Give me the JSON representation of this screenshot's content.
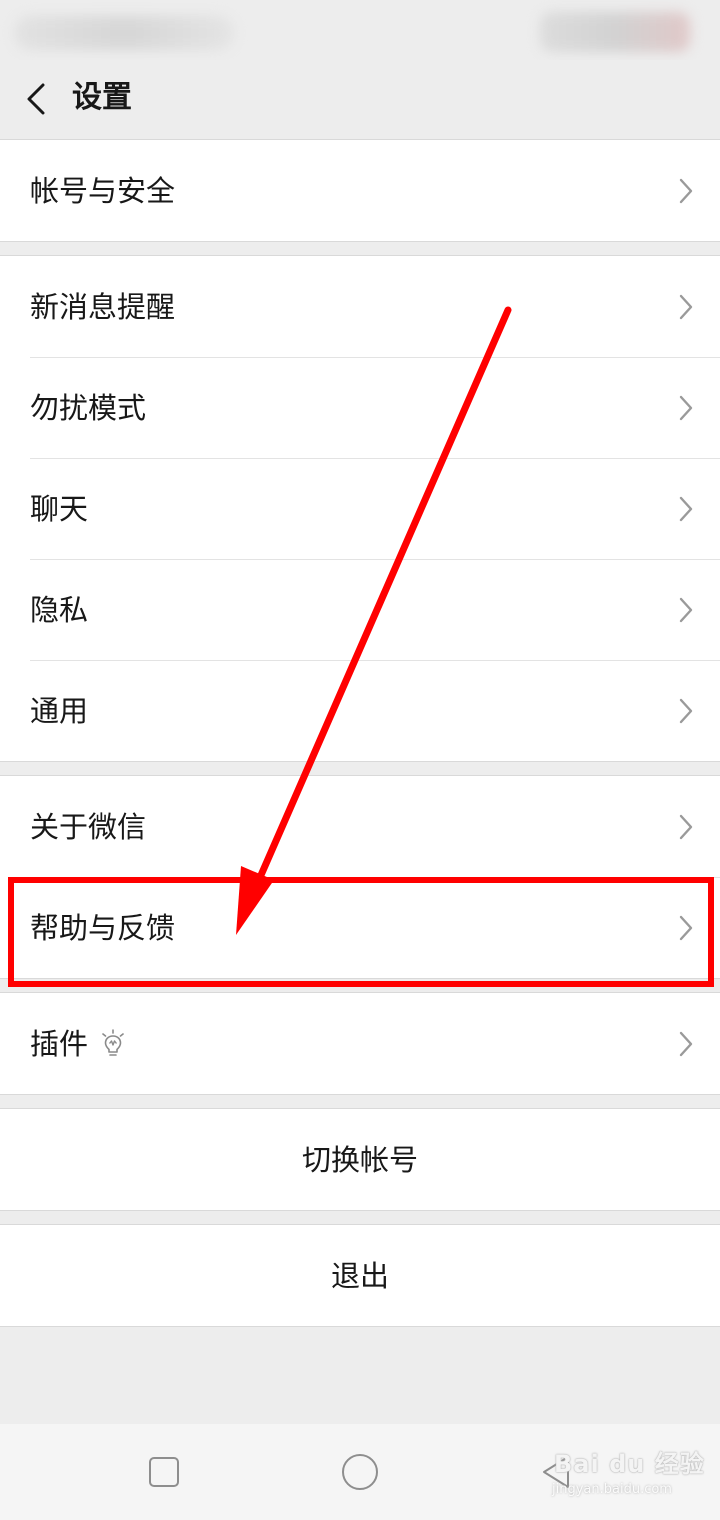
{
  "header": {
    "title": "设置"
  },
  "groups": [
    {
      "items": [
        {
          "label": "帐号与安全"
        }
      ]
    },
    {
      "items": [
        {
          "label": "新消息提醒"
        },
        {
          "label": "勿扰模式"
        },
        {
          "label": "聊天"
        },
        {
          "label": "隐私"
        },
        {
          "label": "通用"
        }
      ]
    },
    {
      "items": [
        {
          "label": "关于微信"
        },
        {
          "label": "帮助与反馈"
        }
      ]
    },
    {
      "items": [
        {
          "label": "插件"
        }
      ]
    }
  ],
  "actions": {
    "switch_account": "切换帐号",
    "logout": "退出"
  },
  "watermark": {
    "main": "Bai du 经验",
    "sub": "jingyan.baidu.com"
  },
  "colors": {
    "annotation": "#ff0000",
    "background": "#ededed",
    "card": "#ffffff"
  },
  "icons": {
    "back": "chevron-left-icon",
    "row_arrow": "chevron-right-icon",
    "plugin_badge": "lightbulb-icon",
    "nav_recent": "square-icon",
    "nav_home": "circle-icon",
    "nav_back": "triangle-back-icon"
  }
}
